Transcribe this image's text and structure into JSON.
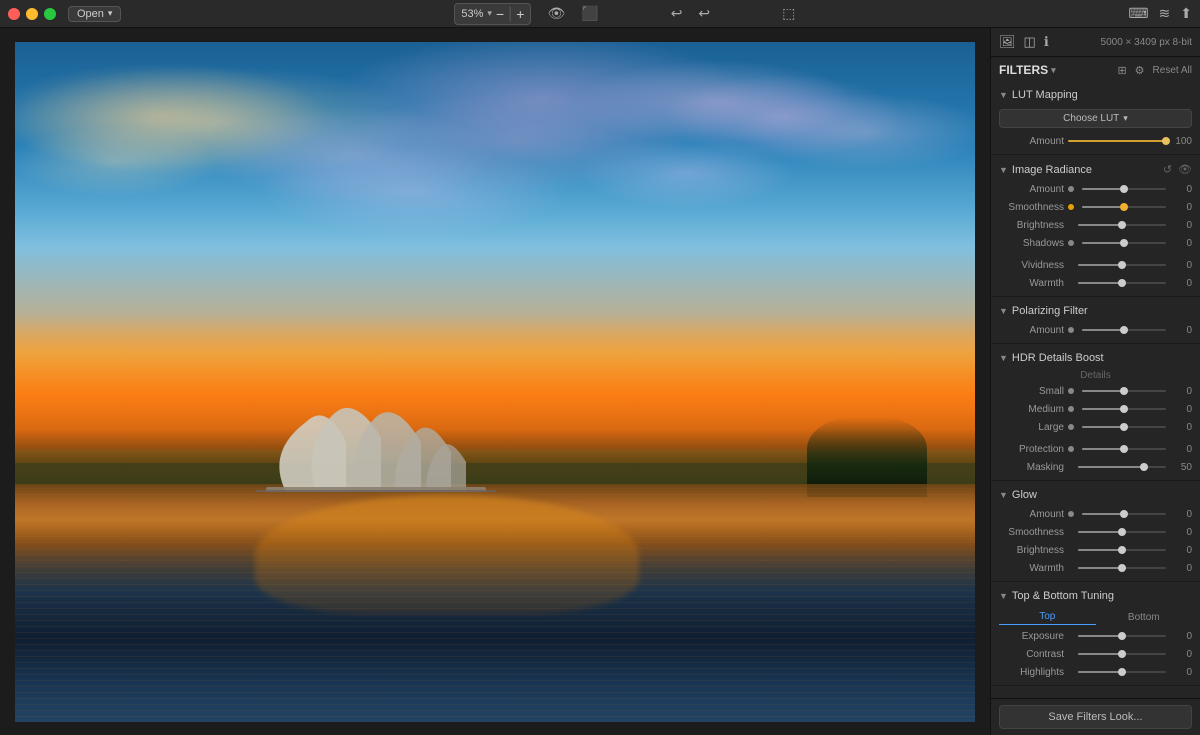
{
  "titlebar": {
    "open_label": "Open",
    "zoom_value": "53%",
    "zoom_minus": "−",
    "zoom_plus": "+",
    "image_info": "5000 × 3409 px   8-bit"
  },
  "filters": {
    "section_title": "FILTERS",
    "reset_label": "Reset All",
    "lut_mapping": {
      "name": "LUT Mapping",
      "choose_label": "Choose LUT",
      "amount_label": "Amount",
      "amount_value": "100",
      "amount_pct": 100
    },
    "image_radiance": {
      "name": "Image Radiance",
      "controls": [
        {
          "label": "Amount",
          "value": "0",
          "pct": 50,
          "dot": true,
          "dot_active": false
        },
        {
          "label": "Smoothness",
          "value": "0",
          "pct": 50,
          "dot": true,
          "dot_active": true
        },
        {
          "label": "Brightness",
          "value": "0",
          "pct": 50,
          "dot": false
        },
        {
          "label": "Shadows",
          "value": "0",
          "pct": 50,
          "dot": false
        },
        {
          "label": "Vividness",
          "value": "0",
          "pct": 50,
          "dot": false
        },
        {
          "label": "Warmth",
          "value": "0",
          "pct": 50,
          "dot": false
        }
      ]
    },
    "polarizing_filter": {
      "name": "Polarizing Filter",
      "controls": [
        {
          "label": "Amount",
          "value": "0",
          "pct": 50,
          "dot": true,
          "dot_active": false
        }
      ]
    },
    "hdr_details": {
      "name": "HDR Details Boost",
      "sub_label": "Details",
      "controls": [
        {
          "label": "Small",
          "value": "0",
          "pct": 50,
          "dot": true,
          "dot_active": false
        },
        {
          "label": "Medium",
          "value": "0",
          "pct": 50,
          "dot": true,
          "dot_active": false
        },
        {
          "label": "Large",
          "value": "0",
          "pct": 50,
          "dot": true,
          "dot_active": false
        },
        {
          "label": "Protection",
          "value": "0",
          "pct": 50,
          "dot": true,
          "dot_active": false
        },
        {
          "label": "Masking",
          "value": "50",
          "pct": 75,
          "dot": false
        }
      ]
    },
    "glow": {
      "name": "Glow",
      "controls": [
        {
          "label": "Amount",
          "value": "0",
          "pct": 50,
          "dot": true,
          "dot_active": false
        },
        {
          "label": "Smoothness",
          "value": "0",
          "pct": 50,
          "dot": false
        },
        {
          "label": "Brightness",
          "value": "0",
          "pct": 50,
          "dot": false
        },
        {
          "label": "Warmth",
          "value": "0",
          "pct": 50,
          "dot": false
        }
      ]
    },
    "top_bottom": {
      "name": "Top & Bottom Tuning",
      "tab_top": "Top",
      "tab_bottom": "Bottom",
      "controls": [
        {
          "label": "Exposure",
          "value": "0",
          "pct": 50,
          "dot": false
        },
        {
          "label": "Contrast",
          "value": "0",
          "pct": 50,
          "dot": false
        },
        {
          "label": "Highlights",
          "value": "0",
          "pct": 50,
          "dot": false
        }
      ]
    }
  },
  "save": {
    "label": "Save Filters Look..."
  }
}
